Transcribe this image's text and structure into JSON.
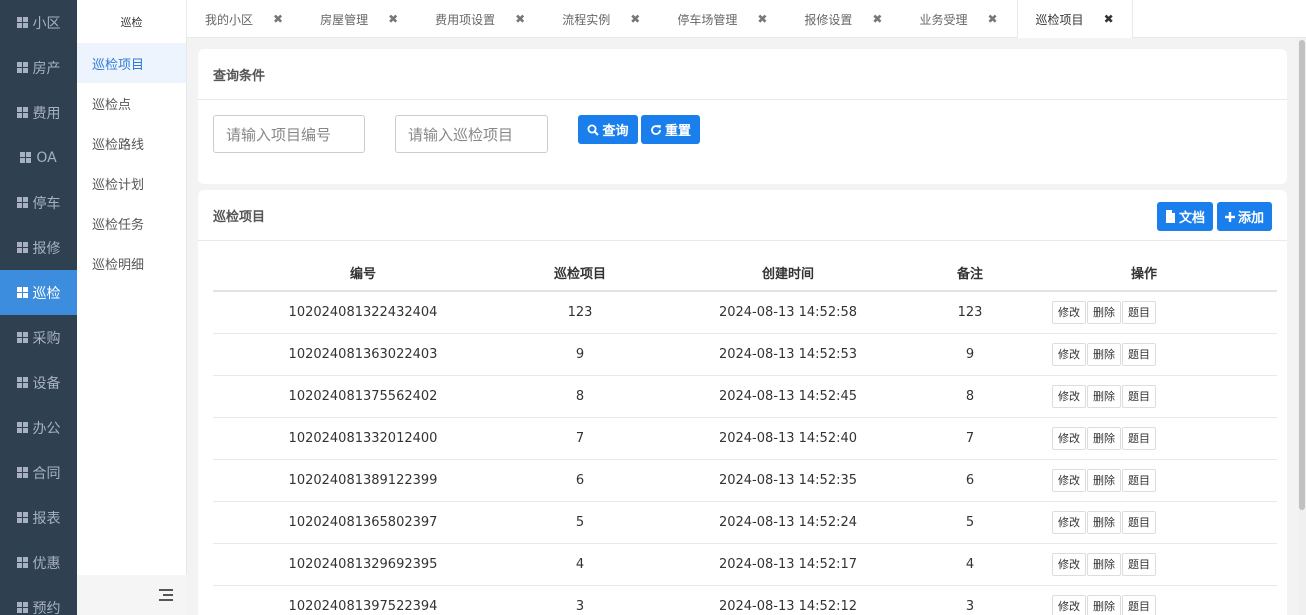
{
  "left_nav": [
    {
      "label": "小区"
    },
    {
      "label": "房产"
    },
    {
      "label": "费用"
    },
    {
      "label": "OA"
    },
    {
      "label": "停车"
    },
    {
      "label": "报修"
    },
    {
      "label": "巡检",
      "active": true
    },
    {
      "label": "采购"
    },
    {
      "label": "设备"
    },
    {
      "label": "办公"
    },
    {
      "label": "合同"
    },
    {
      "label": "报表"
    },
    {
      "label": "优惠"
    },
    {
      "label": "预约"
    }
  ],
  "sub_nav": {
    "title": "巡检",
    "items": [
      {
        "label": "巡检项目",
        "active": true
      },
      {
        "label": "巡检点"
      },
      {
        "label": "巡检路线"
      },
      {
        "label": "巡检计划"
      },
      {
        "label": "巡检任务"
      },
      {
        "label": "巡检明细"
      }
    ]
  },
  "tabs": [
    {
      "label": "我的小区"
    },
    {
      "label": "房屋管理"
    },
    {
      "label": "费用项设置"
    },
    {
      "label": "流程实例"
    },
    {
      "label": "停车场管理"
    },
    {
      "label": "报修设置"
    },
    {
      "label": "业务受理"
    },
    {
      "label": "巡检项目",
      "active": true
    }
  ],
  "tab_close_glyph": "✖",
  "query": {
    "title": "查询条件",
    "code_placeholder": "请输入项目编号",
    "name_placeholder": "请输入巡检项目",
    "search_label": "查询",
    "reset_label": "重置"
  },
  "list": {
    "title": "巡检项目",
    "doc_label": "文档",
    "add_label": "添加",
    "columns": [
      "编号",
      "巡检项目",
      "创建时间",
      "备注",
      "操作"
    ],
    "op_labels": {
      "edit": "修改",
      "delete": "删除",
      "topic": "题目"
    },
    "rows": [
      {
        "code": "102024081322432404",
        "name": "123",
        "time": "2024-08-13 14:52:58",
        "note": "123"
      },
      {
        "code": "102024081363022403",
        "name": "9",
        "time": "2024-08-13 14:52:53",
        "note": "9"
      },
      {
        "code": "102024081375562402",
        "name": "8",
        "time": "2024-08-13 14:52:45",
        "note": "8"
      },
      {
        "code": "102024081332012400",
        "name": "7",
        "time": "2024-08-13 14:52:40",
        "note": "7"
      },
      {
        "code": "102024081389122399",
        "name": "6",
        "time": "2024-08-13 14:52:35",
        "note": "6"
      },
      {
        "code": "102024081365802397",
        "name": "5",
        "time": "2024-08-13 14:52:24",
        "note": "5"
      },
      {
        "code": "102024081329692395",
        "name": "4",
        "time": "2024-08-13 14:52:17",
        "note": "4"
      },
      {
        "code": "102024081397522394",
        "name": "3",
        "time": "2024-08-13 14:52:12",
        "note": "3"
      }
    ]
  },
  "colors": {
    "nav_bg": "#2f4050",
    "nav_active": "#3c8dde",
    "accent": "#1a7fed"
  }
}
